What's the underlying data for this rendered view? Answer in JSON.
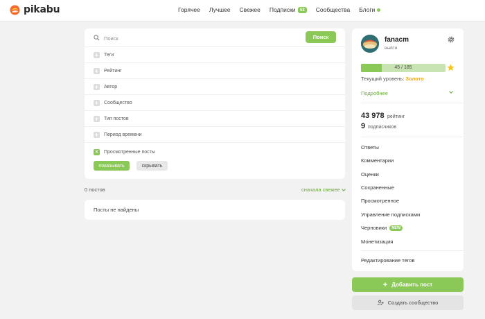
{
  "header": {
    "logo_text": "pikabu",
    "nav": [
      {
        "label": "Горячее"
      },
      {
        "label": "Лучшее"
      },
      {
        "label": "Свежее"
      },
      {
        "label": "Подписки",
        "badge": "53"
      },
      {
        "label": "Сообщества"
      },
      {
        "label": "Блоги",
        "dot": true
      }
    ],
    "accent_color": "#8ac858"
  },
  "filters": {
    "search_placeholder": "Поиск",
    "search_button": "Поиск",
    "rows": [
      "Теги",
      "Рейтинг",
      "Автор",
      "Сообщество",
      "Тип постов",
      "Период времени"
    ],
    "viewed_posts_label": "Просмотренные посты",
    "viewed_posts_checked": true,
    "show_button": "показывать",
    "hide_button": "скрывать"
  },
  "results": {
    "count_text": "0 постов",
    "sort_label": "сначала свежее",
    "empty_text": "Посты не найдены"
  },
  "profile": {
    "username": "fanacm",
    "logout": "выйти",
    "progress_text": "45 / 185",
    "progress_value": 45,
    "progress_max": 185,
    "level_label": "Текущий уровень:",
    "level_value": "Золото",
    "more_label": "Подробнее",
    "rating_value": "43 978",
    "rating_label": "рейтинг",
    "subscribers_value": "9",
    "subscribers_label": "подписчиков",
    "menu": [
      "Ответы",
      "Комментарии",
      "Оценки",
      "Сохраненные",
      "Просмотренное",
      "Управление подписками",
      "Черновики",
      "Монетизация"
    ],
    "new_badge": "NEW",
    "edit_tags": "Редактирование тегов"
  },
  "actions": {
    "add_post": "Добавить пост",
    "create_community": "Создать сообщество"
  }
}
